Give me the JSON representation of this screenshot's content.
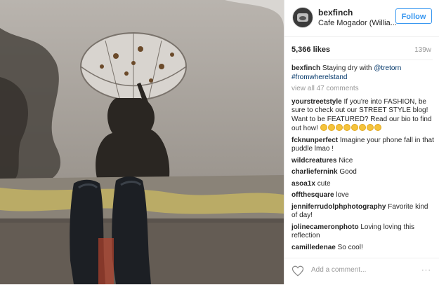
{
  "post": {
    "image_alt": "Reflection of person with umbrella in puddle, black rain boots on curb",
    "username": "bexfinch",
    "location": "Cafe Mogador (Willia...",
    "follow_label": "Follow",
    "likes": "5,366 likes",
    "time": "139w",
    "caption_user": "bexfinch",
    "caption_text": " Staying dry with ",
    "caption_mention": "@tretorn",
    "caption_hashtag": "#fromwherelstand",
    "view_all": "view all 47 comments"
  },
  "comments": [
    {
      "user": "yourstreetstyle",
      "text": " If you're into FASHION, be sure to check out our STREET STYLE blog! Want to be FEATURED? Read our bio to find out how!"
    },
    {
      "user": "fcknunperfect",
      "text": " Imagine your phone fall in that puddle lmao !"
    },
    {
      "user": "wildcreatures",
      "text": " Nice"
    },
    {
      "user": "charliefernink",
      "text": " Good"
    },
    {
      "user": "asoa1x",
      "text": " cute"
    },
    {
      "user": "offthesquare",
      "text": " love"
    },
    {
      "user": "jenniferrudolphphotography",
      "text": " Favorite kind of day!"
    },
    {
      "user": "jolinecameronphoto",
      "text": " Loving loving this reflection"
    },
    {
      "user": "camilledenae",
      "text": " So cool!"
    }
  ],
  "footer": {
    "add_comment_placeholder": "Add a comment...",
    "more_label": "···"
  },
  "colors": {
    "accent": "#3897f0",
    "link": "#003569"
  }
}
